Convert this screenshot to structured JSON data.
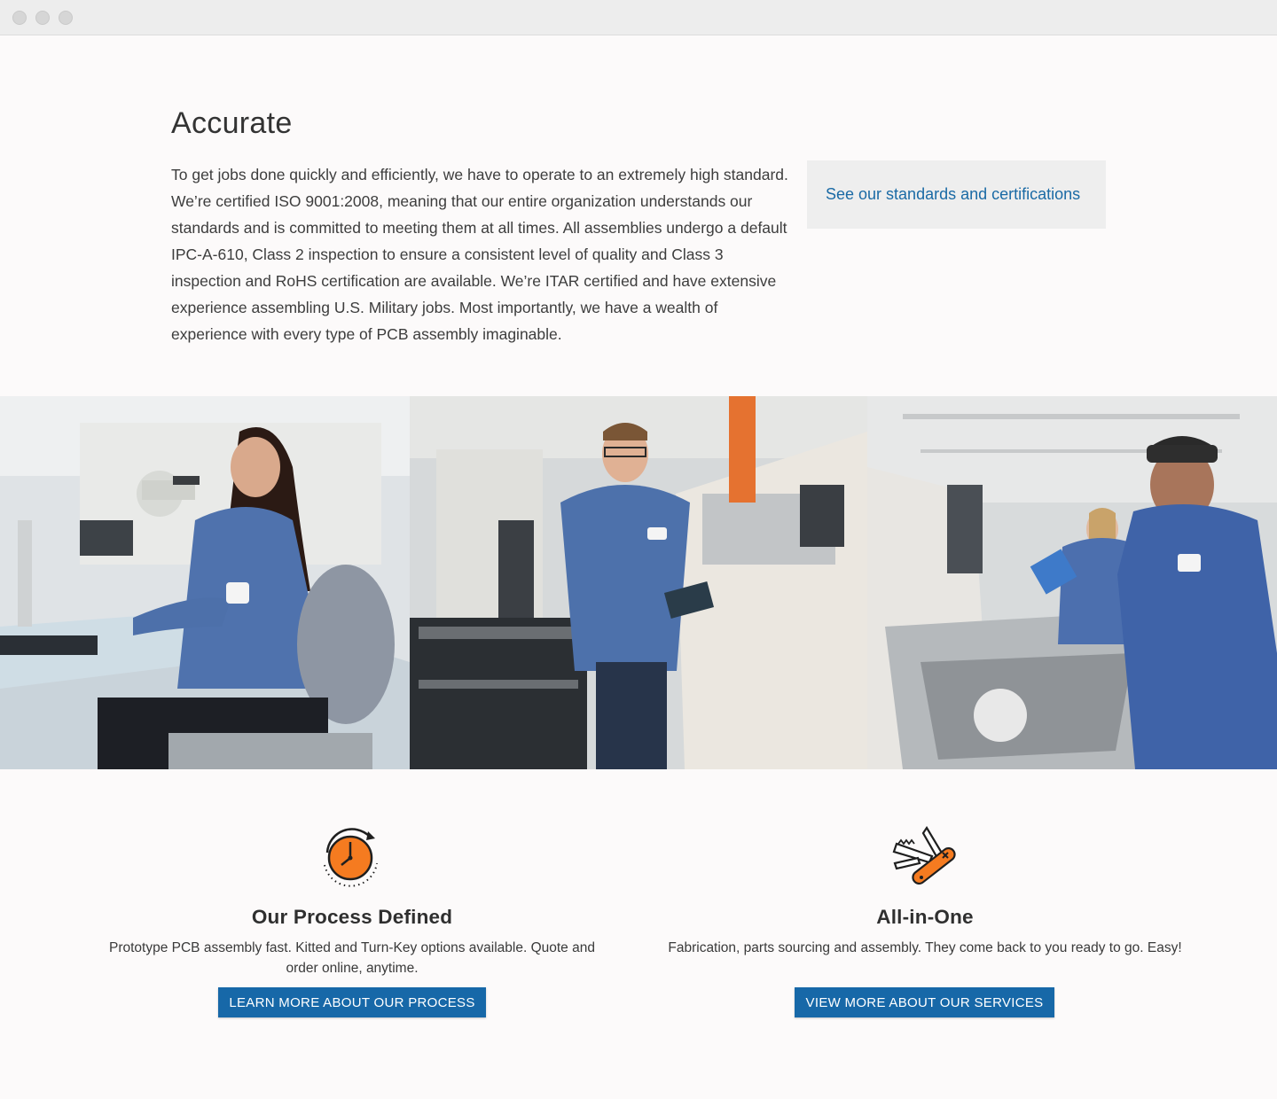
{
  "window": {
    "controls": [
      "close",
      "minimize",
      "maximize"
    ]
  },
  "accurate": {
    "title": "Accurate",
    "body": "To get jobs done quickly and efficiently, we have to operate to an extremely high standard. We’re certified ISO 9001:2008, meaning that our entire organization understands our standards and is committed to meeting them at all times. All assemblies undergo a default IPC-A-610, Class 2 inspection to ensure a consistent level of quality and Class 3 inspection and RoHS certification are available. We’re ITAR certified and have extensive experience assembling U.S. Military jobs. Most importantly, we have a wealth of experience with every type of PCB assembly imaginable.",
    "link_label": "See our standards and certifications"
  },
  "photos": [
    {
      "subject": "worker-at-microscope"
    },
    {
      "subject": "worker-holding-pcb"
    },
    {
      "subject": "workers-at-machine"
    }
  ],
  "features": [
    {
      "icon": "clock-icon",
      "title": "Our Process Defined",
      "description": "Prototype PCB assembly fast. Kitted and Turn-Key options available. Quote and order online, anytime.",
      "button_label": "LEARN MORE ABOUT OUR PROCESS"
    },
    {
      "icon": "swiss-army-knife-icon",
      "title": "All-in-One",
      "description": "Fabrication, parts sourcing and assembly. They come back to you ready to go. Easy!",
      "button_label": "VIEW MORE ABOUT OUR SERVICES"
    }
  ],
  "colors": {
    "accent": "#1768a8",
    "link": "#1a6aa5",
    "icon_orange": "#f57b20",
    "background": "#fcfafa"
  }
}
